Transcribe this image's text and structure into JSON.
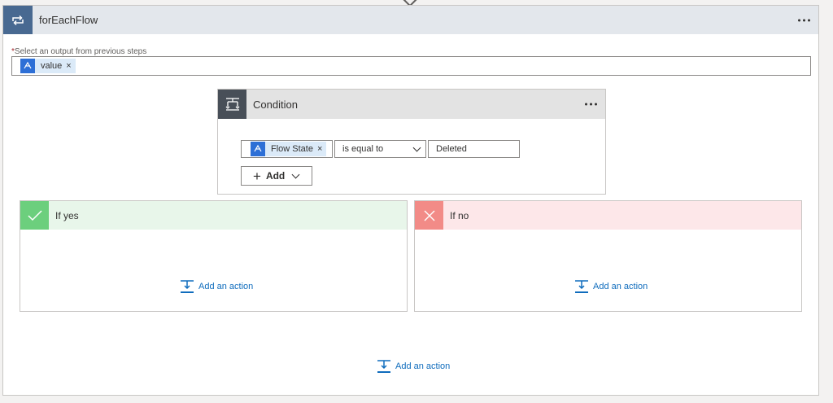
{
  "foreach": {
    "title": "forEachFlow",
    "select_label_required": "*",
    "select_label": "Select an output from previous steps",
    "token_value": "value",
    "token_remove": "×",
    "add_action": "Add an action"
  },
  "condition": {
    "title": "Condition",
    "left_token": "Flow State",
    "left_token_remove": "×",
    "operator": "is equal to",
    "right_value": "Deleted",
    "add_label": "Add"
  },
  "branches": {
    "yes": {
      "title": "If yes",
      "add_action": "Add an action"
    },
    "no": {
      "title": "If no",
      "add_action": "Add an action"
    }
  },
  "colors": {
    "foreach_header": "#e3e7ec",
    "foreach_icon": "#486991",
    "condition_icon": "#484f58",
    "yes_header": "#e8f6ea",
    "yes_icon": "#6ccf7d",
    "no_header": "#fde7e9",
    "no_icon": "#f28b87",
    "link": "#0f6cbd",
    "token_icon": "#2d6fd6"
  }
}
